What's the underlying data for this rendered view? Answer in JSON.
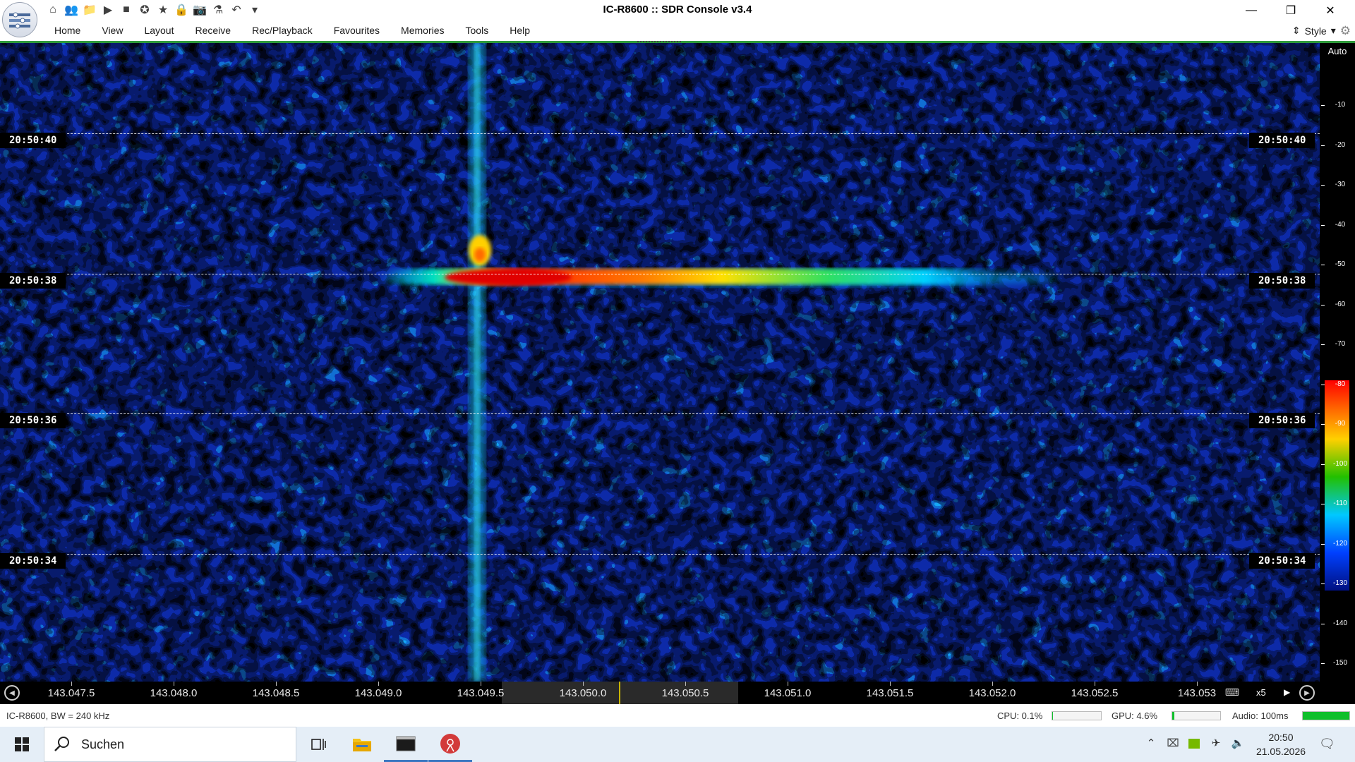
{
  "window": {
    "title": "IC-R8600 :: SDR Console v3.4",
    "minimize_glyph": "—",
    "restore_glyph": "❐",
    "close_glyph": "✕"
  },
  "quick_access": [
    {
      "name": "home-icon",
      "glyph": "⌂"
    },
    {
      "name": "users-icon",
      "glyph": "👥"
    },
    {
      "name": "folder-icon",
      "glyph": "📁"
    },
    {
      "name": "play-icon",
      "glyph": "▶"
    },
    {
      "name": "stop-icon",
      "glyph": "■"
    },
    {
      "name": "compass-icon",
      "glyph": "✪"
    },
    {
      "name": "star-icon",
      "glyph": "★"
    },
    {
      "name": "lock-icon",
      "glyph": "🔒"
    },
    {
      "name": "camera-icon",
      "glyph": "📷"
    },
    {
      "name": "flask-icon",
      "glyph": "⚗"
    },
    {
      "name": "undo-icon",
      "glyph": "↶"
    },
    {
      "name": "customize-dropdown-icon",
      "glyph": "▾"
    }
  ],
  "menu": [
    "Home",
    "View",
    "Layout",
    "Receive",
    "Rec/Playback",
    "Favourites",
    "Memories",
    "Tools",
    "Help"
  ],
  "style_label": "Style",
  "waterfall": {
    "time_markers": [
      {
        "label": "20:50:40"
      },
      {
        "label": "20:50:38"
      },
      {
        "label": "20:50:36"
      },
      {
        "label": "20:50:34"
      }
    ]
  },
  "scale": {
    "auto_label": "Auto",
    "ticks": [
      "-10",
      "-20",
      "-30",
      "-40",
      "-50",
      "-60",
      "-70",
      "-80",
      "-90",
      "-100",
      "-110",
      "-120",
      "-130",
      "-140",
      "-150"
    ]
  },
  "freq_axis": {
    "labels": [
      "143.047.5",
      "143.048.0",
      "143.048.5",
      "143.049.0",
      "143.049.5",
      "143.050.0",
      "143.050.5",
      "143.051.0",
      "143.051.5",
      "143.052.0",
      "143.052.5",
      "143.053"
    ],
    "zoom": "x5"
  },
  "status": {
    "left": "IC-R8600, BW = 240 kHz",
    "cpu": "CPU: 0.1%",
    "cpu_load": 0.01,
    "gpu": "GPU: 4.6%",
    "gpu_load": 0.05,
    "audio": "Audio: 100ms",
    "audio_level": 1.0
  },
  "taskbar": {
    "search_text": "Suchen",
    "clock_time": "20:50",
    "clock_date": "21.05.2026"
  },
  "colors": {
    "accent_line": "#2f9a3b",
    "meter_green": "#0fbf2b",
    "waterfall_bg": "#0a1c8a"
  }
}
